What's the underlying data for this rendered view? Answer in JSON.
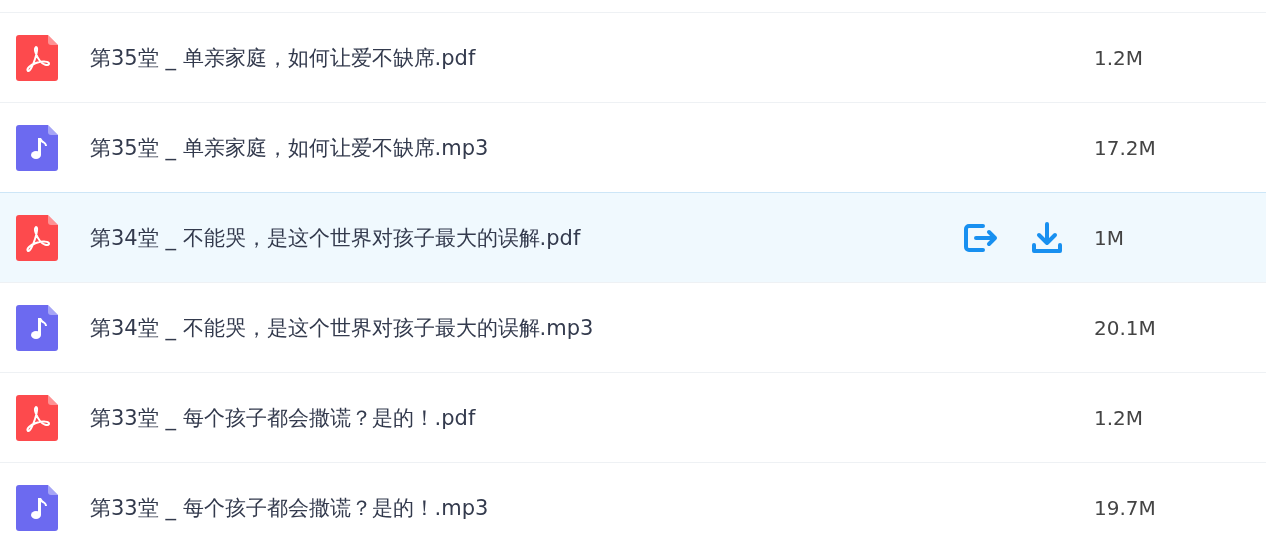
{
  "files": [
    {
      "kind": "pdf",
      "name": "第35堂 _ 单亲家庭，如何让爱不缺席.pdf",
      "size": "1.2M",
      "selected": false
    },
    {
      "kind": "mp3",
      "name": "第35堂 _ 单亲家庭，如何让爱不缺席.mp3",
      "size": "17.2M",
      "selected": false
    },
    {
      "kind": "pdf",
      "name": "第34堂 _ 不能哭，是这个世界对孩子最大的误解.pdf",
      "size": "1M",
      "selected": true
    },
    {
      "kind": "mp3",
      "name": "第34堂 _ 不能哭，是这个世界对孩子最大的误解.mp3",
      "size": "20.1M",
      "selected": false
    },
    {
      "kind": "pdf",
      "name": "第33堂 _ 每个孩子都会撒谎？是的！.pdf",
      "size": "1.2M",
      "selected": false
    },
    {
      "kind": "mp3",
      "name": "第33堂 _ 每个孩子都会撒谎？是的！.mp3",
      "size": "19.7M",
      "selected": false
    }
  ]
}
